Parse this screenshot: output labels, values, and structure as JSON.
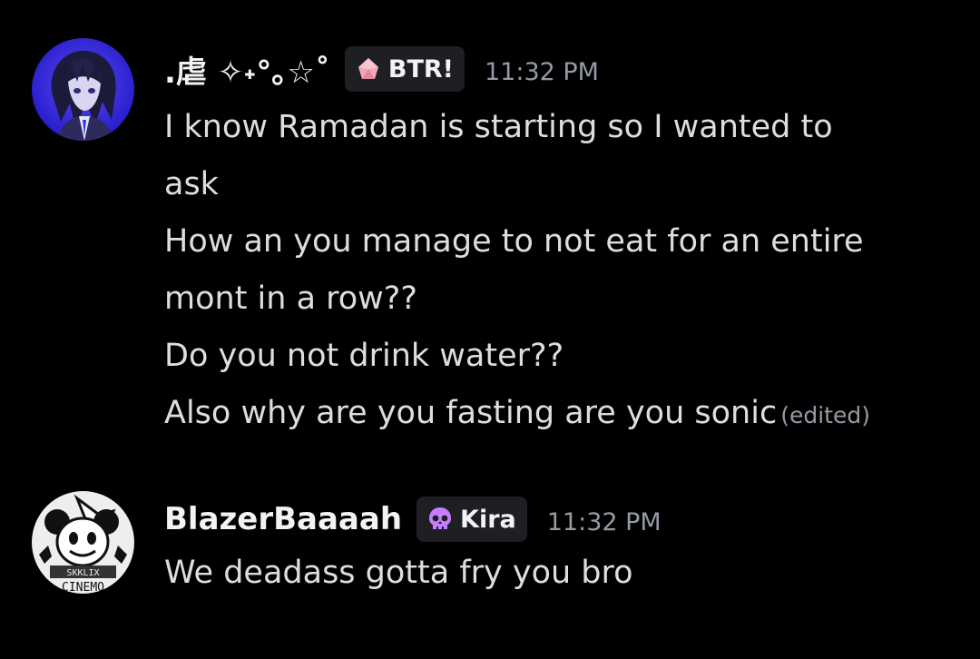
{
  "messages": [
    {
      "username": ".虐 ✧˖°｡☆˚",
      "tag": {
        "label": "BTR!",
        "icon": "pink-gem-icon",
        "icon_color": "#f4a6b8"
      },
      "timestamp": "11:32 PM",
      "lines": [
        "I know Ramadan is starting so I wanted to",
        "ask",
        "How an you manage to not eat for an entire",
        "mont in a row??",
        "Do you not drink water??",
        "Also why are you fasting are you sonic"
      ],
      "edited_label": "(edited)",
      "avatar": "anime-character-avatar",
      "avatar_color": "#3a2ad8"
    },
    {
      "username": "BlazerBaaaah",
      "tag": {
        "label": "Kira",
        "icon": "skull-icon",
        "icon_color": "#c77dff"
      },
      "timestamp": "11:32 PM",
      "lines": [
        "We deadass gotta fry you bro"
      ],
      "avatar": "cartoon-mascot-avatar",
      "avatar_caption": "CINEMO"
    }
  ],
  "colors": {
    "background": "#000000",
    "username": "#f2f3f5",
    "message_text": "#dbdee1",
    "muted": "#949ba4",
    "tag_bg": "#1e1f22"
  }
}
